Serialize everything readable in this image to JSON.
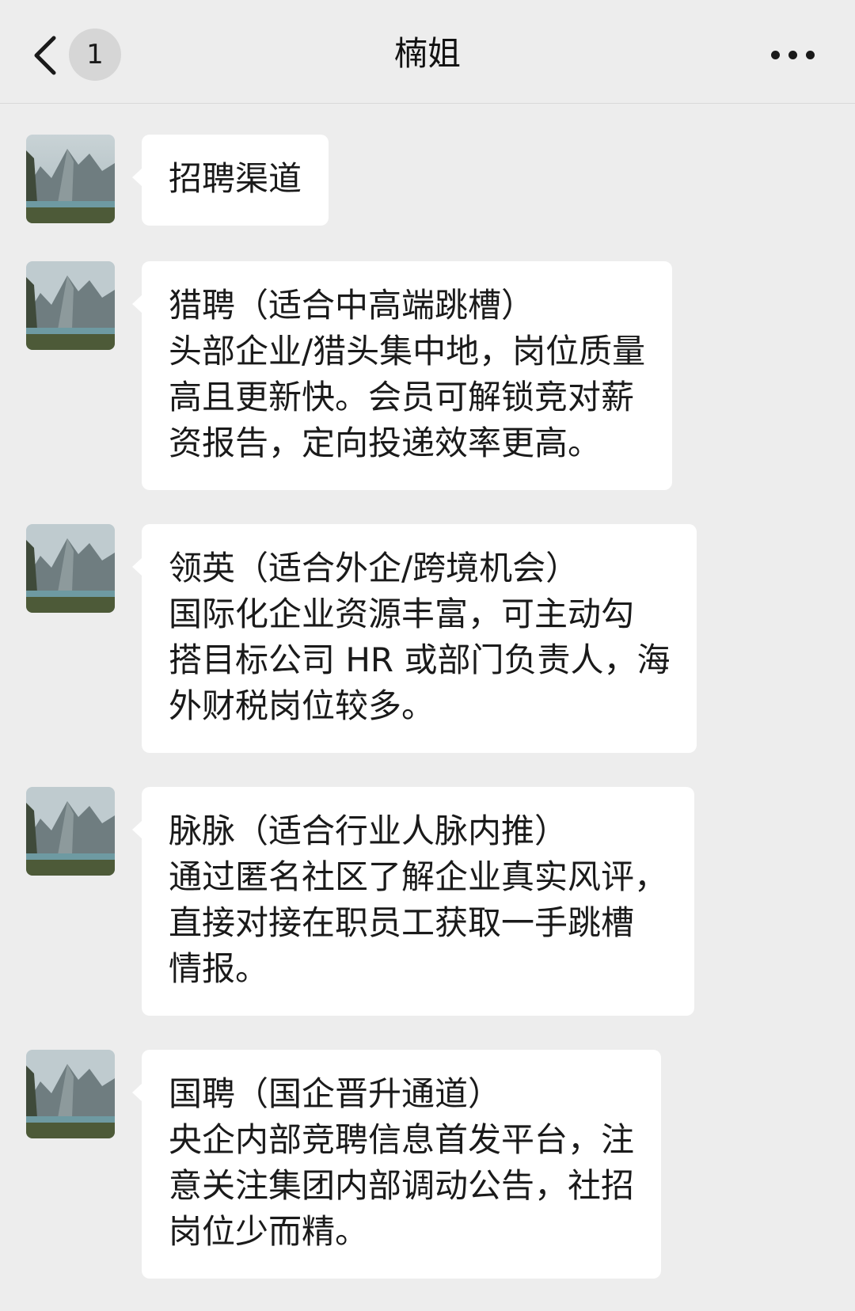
{
  "header": {
    "back_icon": "chevron-left-icon",
    "unread_count": "1",
    "title": "楠姐",
    "more_icon": "more-dots-icon"
  },
  "messages": [
    {
      "avatar": "mountain-lake-avatar",
      "lines": [
        "招聘渠道"
      ]
    },
    {
      "avatar": "mountain-lake-avatar",
      "lines": [
        "猎聘（适合中高端跳槽）",
        "头部企业/猎头集中地，岗位质量",
        "高且更新快。会员可解锁竞对薪",
        "资报告，定向投递效率更高。"
      ]
    },
    {
      "avatar": "mountain-lake-avatar",
      "lines": [
        "领英（适合外企/跨境机会）",
        "国际化企业资源丰富，可主动勾",
        "搭目标公司 HR 或部门负责人，海",
        "外财税岗位较多。"
      ]
    },
    {
      "avatar": "mountain-lake-avatar",
      "lines": [
        "脉脉（适合行业人脉内推）",
        "通过匿名社区了解企业真实风评，",
        "直接对接在职员工获取一手跳槽",
        "情报。"
      ]
    },
    {
      "avatar": "mountain-lake-avatar",
      "lines": [
        "国聘（国企晋升通道）",
        "央企内部竞聘信息首发平台，注",
        "意关注集团内部调动公告，社招",
        "岗位少而精。"
      ]
    }
  ]
}
